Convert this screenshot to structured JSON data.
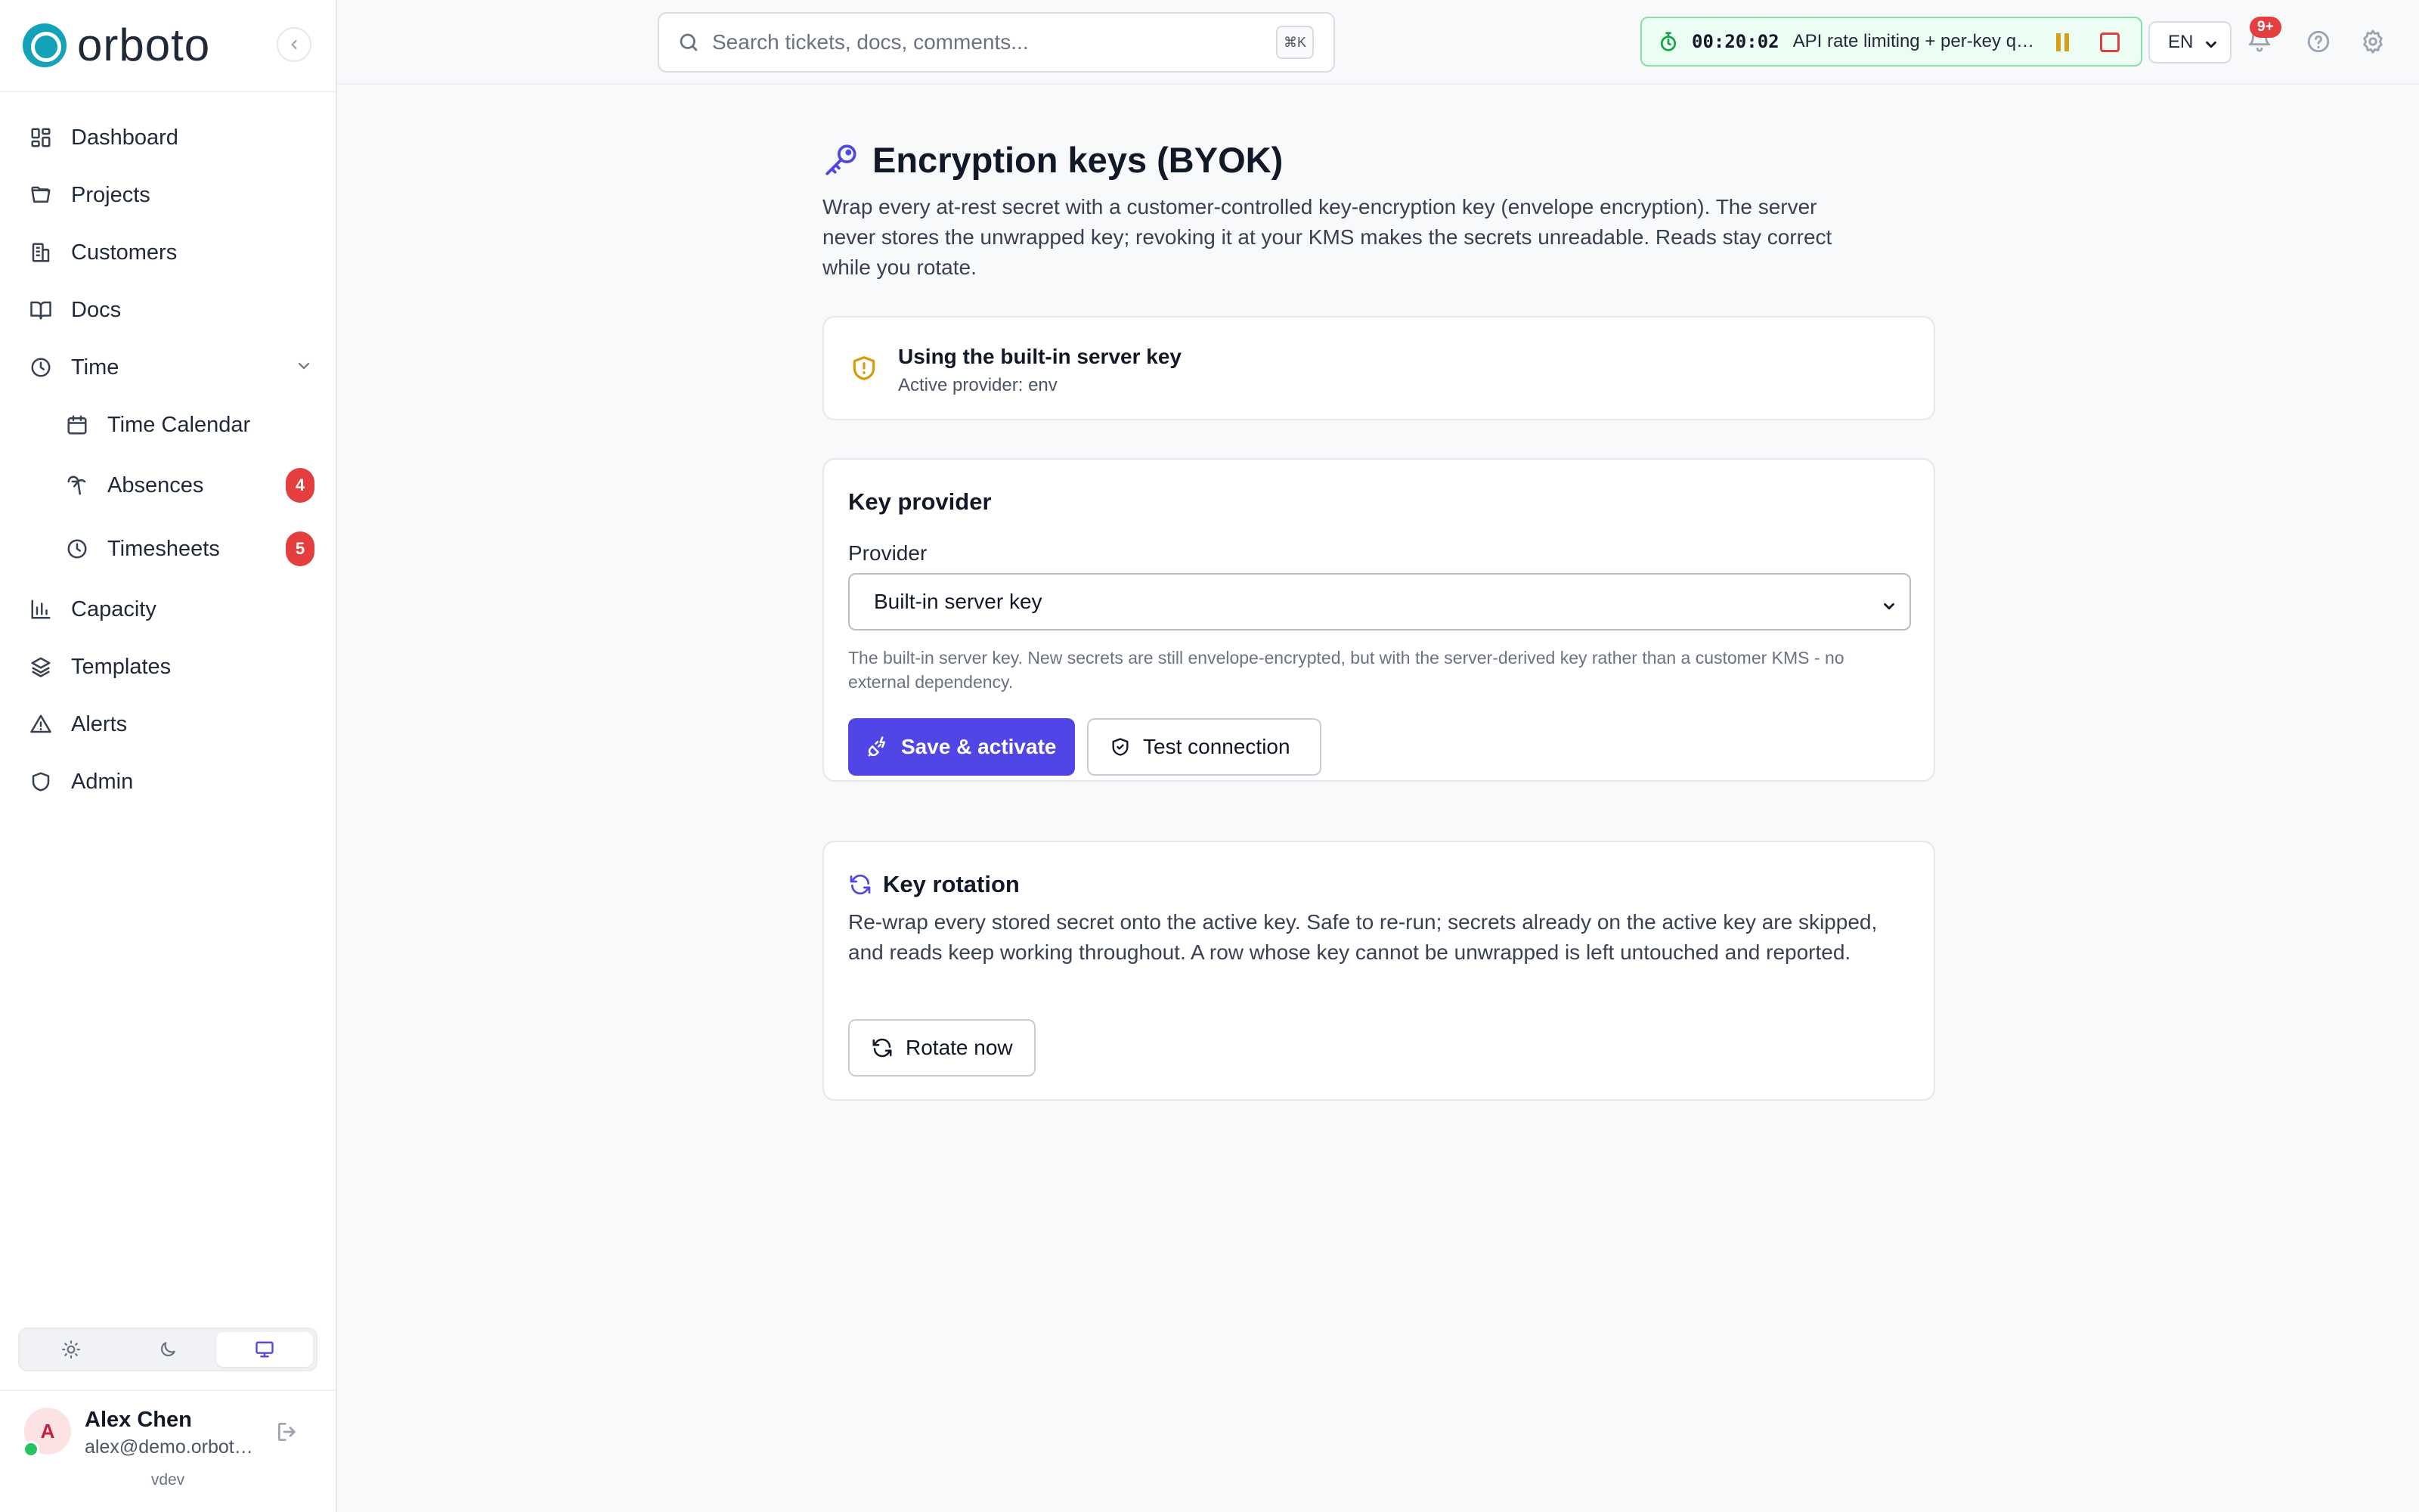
{
  "app": {
    "brand": "orboto",
    "version": "vdev"
  },
  "sidebar": {
    "items": [
      {
        "key": "dashboard",
        "label": "Dashboard",
        "icon": "dashboard-icon"
      },
      {
        "key": "projects",
        "label": "Projects",
        "icon": "folder-icon"
      },
      {
        "key": "customers",
        "label": "Customers",
        "icon": "building-icon"
      },
      {
        "key": "docs",
        "label": "Docs",
        "icon": "book-icon"
      },
      {
        "key": "time",
        "label": "Time",
        "icon": "clock-icon",
        "expanded": true
      },
      {
        "key": "time-calendar",
        "label": "Time Calendar",
        "icon": "calendar-icon"
      },
      {
        "key": "absences",
        "label": "Absences",
        "icon": "palm-tree-icon",
        "badge": "4"
      },
      {
        "key": "timesheets",
        "label": "Timesheets",
        "icon": "clock-icon",
        "badge": "5"
      },
      {
        "key": "capacity",
        "label": "Capacity",
        "icon": "bar-chart-icon"
      },
      {
        "key": "templates",
        "label": "Templates",
        "icon": "layers-icon"
      },
      {
        "key": "alerts",
        "label": "Alerts",
        "icon": "alert-triangle-icon"
      },
      {
        "key": "admin",
        "label": "Admin",
        "icon": "shield-icon"
      }
    ],
    "theme": {
      "options": [
        "light",
        "dark",
        "system"
      ],
      "selected": "system"
    },
    "user": {
      "initial": "A",
      "name": "Alex Chen",
      "email": "alex@demo.orboto.io",
      "status": "online"
    }
  },
  "topbar": {
    "search_placeholder": "Search tickets, docs, comments...",
    "search_shortcut": "⌘K",
    "timer": {
      "elapsed": "00:20:02",
      "task": "API rate limiting + per-key quotas"
    },
    "language": "EN",
    "notifications_badge": "9+"
  },
  "page": {
    "title": "Encryption keys (BYOK)",
    "description": "Wrap every at-rest secret with a customer-controlled key-encryption key (envelope encryption). The server never stores the unwrapped key; revoking it at your KMS makes the secrets unreadable. Reads stay correct while you rotate.",
    "status": {
      "title": "Using the built-in server key",
      "subtitle": "Active provider: env"
    },
    "provider_card": {
      "heading": "Key provider",
      "field_label": "Provider",
      "selected": "Built-in server key",
      "help": "The built-in server key. New secrets are still envelope-encrypted, but with the server-derived key rather than a customer KMS - no external dependency.",
      "save_label": "Save & activate",
      "test_label": "Test connection"
    },
    "rotation_card": {
      "heading": "Key rotation",
      "description": "Re-wrap every stored secret onto the active key. Safe to re-run; secrets already on the active key are skipped, and reads keep working throughout. A row whose key cannot be unwrapped is left untouched and reported.",
      "rotate_label": "Rotate now"
    }
  },
  "colors": {
    "accent": "#4f46e5",
    "brand": "#14a2b8",
    "danger": "#e53e3e",
    "timer_bg": "#ecfdf3",
    "warning": "#d99a06"
  }
}
